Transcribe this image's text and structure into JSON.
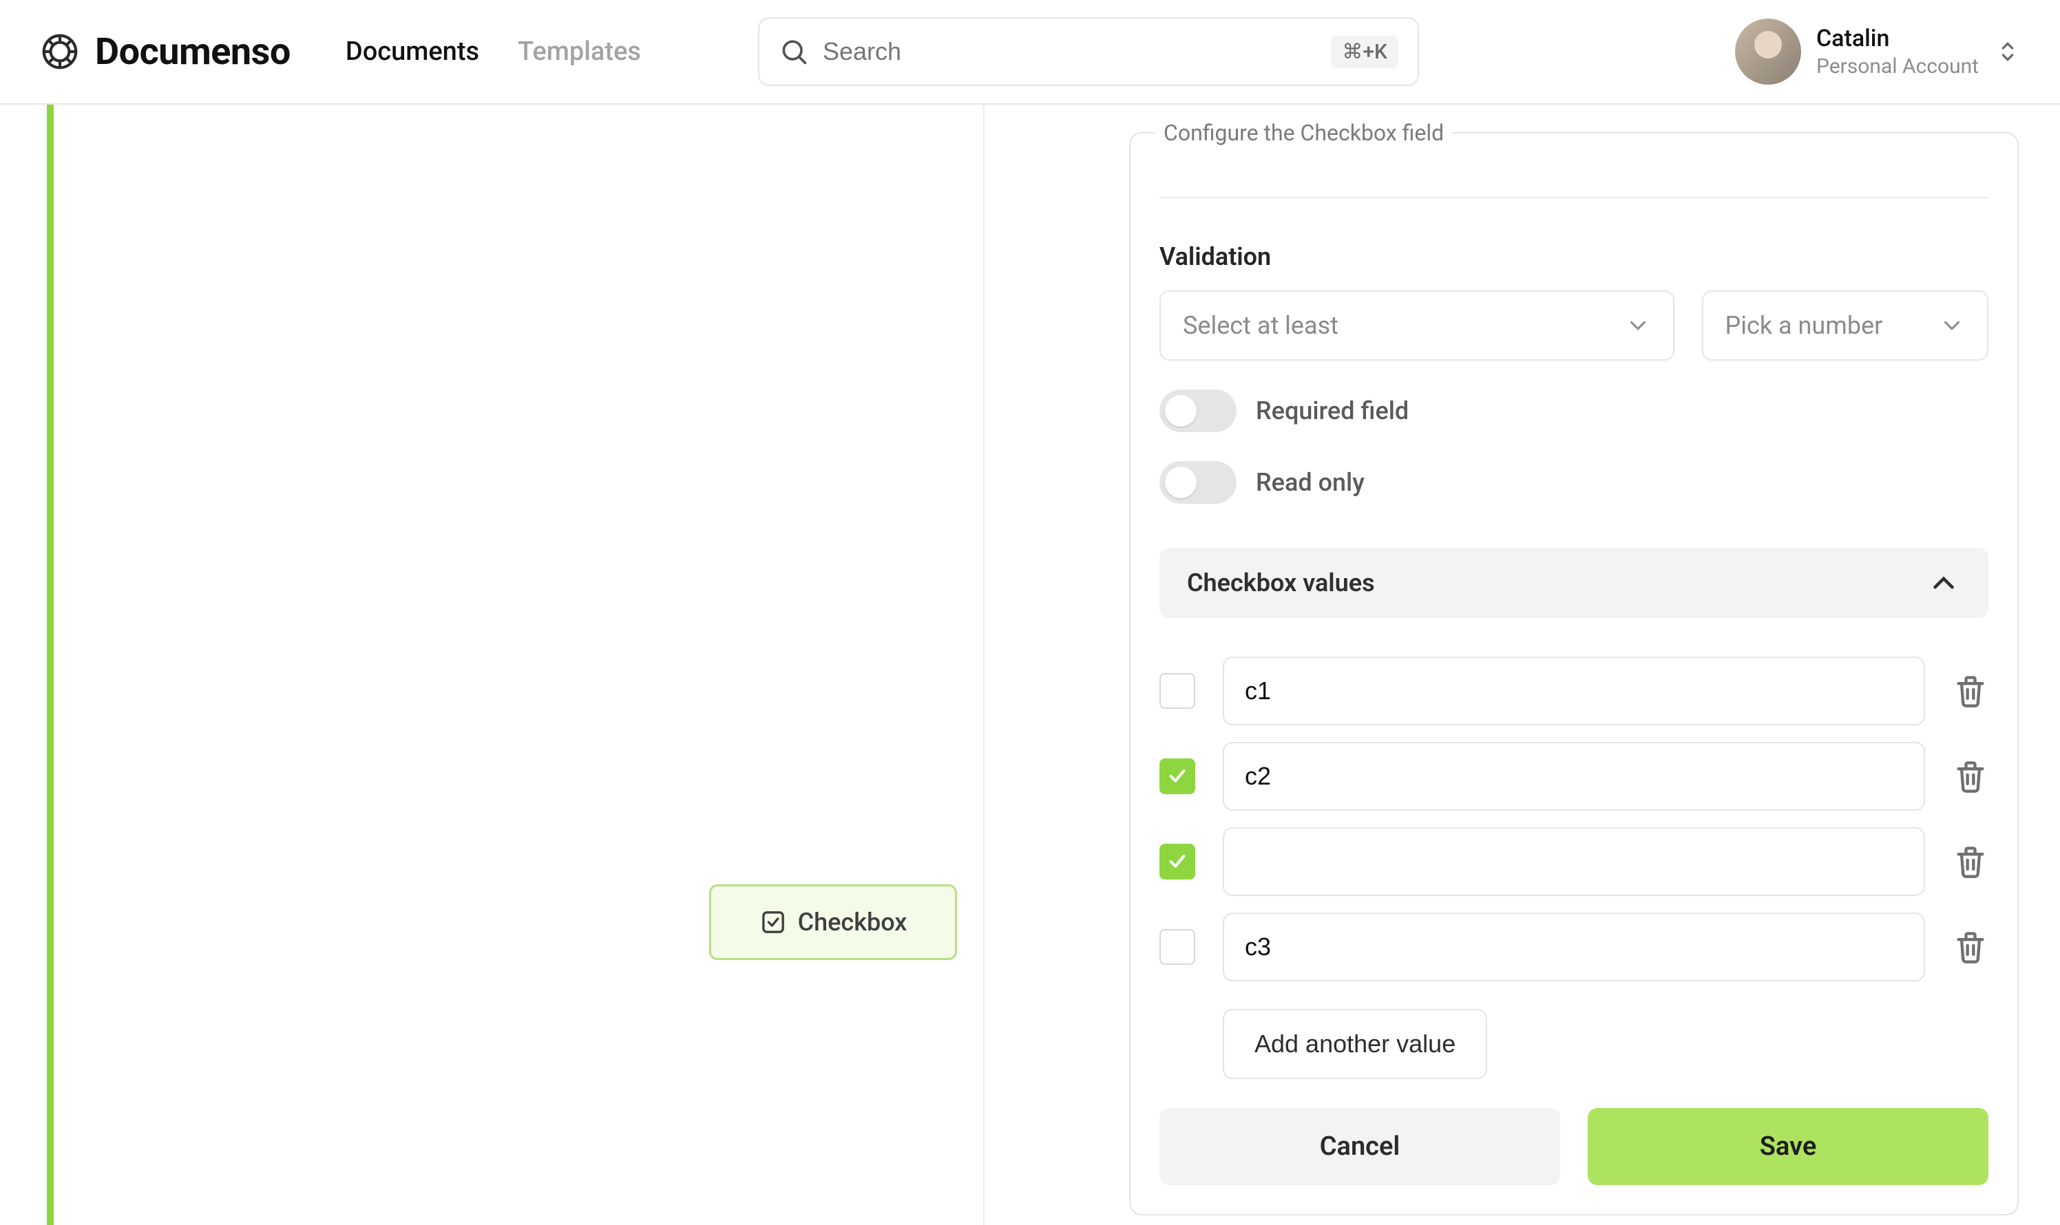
{
  "brand": {
    "name": "Documenso"
  },
  "nav": {
    "documents": "Documents",
    "templates": "Templates"
  },
  "search": {
    "placeholder": "Search",
    "shortcut": "⌘+K"
  },
  "account": {
    "name": "Catalin",
    "subtitle": "Personal Account"
  },
  "document_preview": {
    "field_label": "Checkbox"
  },
  "panel": {
    "legend": "Configure the Checkbox field",
    "validation_label": "Validation",
    "validation_rule_placeholder": "Select at least",
    "validation_count_placeholder": "Pick a number",
    "required_label": "Required field",
    "readonly_label": "Read only",
    "values_header": "Checkbox values",
    "values": [
      {
        "checked": false,
        "value": "c1"
      },
      {
        "checked": true,
        "value": "c2"
      },
      {
        "checked": true,
        "value": ""
      },
      {
        "checked": false,
        "value": "c3"
      }
    ],
    "add_value_label": "Add another value",
    "cancel_label": "Cancel",
    "save_label": "Save"
  }
}
